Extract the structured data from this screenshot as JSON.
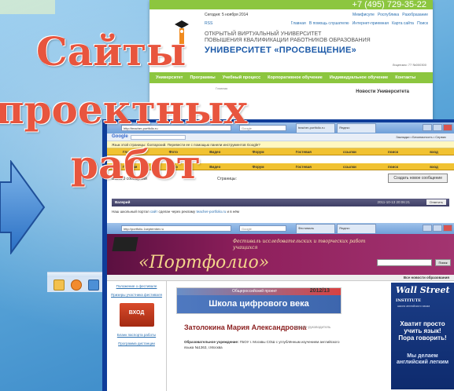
{
  "slide": {
    "title_lines": [
      "Сайты",
      "проектных",
      "работ"
    ],
    "colors": {
      "title": "#e8553e",
      "background": "#5ba6d9",
      "accent_green": "#8cc63f"
    }
  },
  "university_site": {
    "phone": "+7 (495) 729-35-22",
    "date": "Сегодня: 5 ноября 2014",
    "top_links": [
      "Мемфисупе",
      "Роспублика",
      "Разобразание"
    ],
    "rss": "RSS",
    "sub_links": [
      "Главная",
      "В помощь слушателю",
      "Интернет-приемная",
      "Карта сайта",
      "Поиск"
    ],
    "tagline_1": "ОТКРЫТЫЙ ВИРТУАЛЬНЫЙ УНИВЕРСИТЕТ",
    "tagline_2": "ПОВЫШЕНИЯ КВАЛИФИКАЦИИ РАБОТНИКОВ ОБРАЗОВАНИЯ",
    "name": "УНИВЕРСИТЕТ «ПРОСВЕЩЕНИЕ»",
    "license": "Лицензия: 77 №000300",
    "nav": [
      "Университет",
      "Программы",
      "Учебный процесс",
      "Корпоративное обучение",
      "Индивидуальное обучение",
      "Контакты"
    ],
    "breadcrumb": "Главная",
    "news_heading": "Новости Университета"
  },
  "browser_forum": {
    "url": "http://teacher-portfolio.ru",
    "search_placeholder": "Google",
    "tabs": [
      "teacher-portfolio.ru",
      "Яндекс"
    ],
    "google_bar_label": "Google",
    "toolbar_items": "Закладки • Безопасность • Сервис",
    "infobar": "Язык этой страницы: болгарский. Перевести ее с помощью панели инструментов Google?",
    "nav": [
      "Главная",
      "Фото",
      "Видео",
      "Форум",
      "Гостевая",
      "ссылки",
      "поиск",
      "вход"
    ],
    "all_messages": "Всего 0 сообщений",
    "pages_label": "Страницы:",
    "new_message_button": "Создать новое сообщение",
    "post_author": "Валерий",
    "post_date": "2011-10-13 20:06:21",
    "reply_button": "Ответить",
    "post_text_prefix": "Наш школьный портал",
    "post_link_1": "сайт",
    "post_text_mid": "сделан через рекламу",
    "post_link_2": "teacher-portfolio.ru",
    "post_text_suffix": "и в нём"
  },
  "browser_portfolio": {
    "url": "http://portfolio.1september.ru",
    "search_placeholder": "Google",
    "tabs": [
      "Фестиваль",
      "Яндекс"
    ],
    "festival_text": "Фестиваль исследовательских и творческих работ учащихся",
    "portfolio_title": "«Портфолио»",
    "search_button": "Поиск",
    "all_news": "Все новости образования",
    "side_links": [
      "Положение о фестивале",
      "Призеры участника фестиваля",
      "Бланк паспорта работы",
      "Программа дистанции"
    ],
    "login_label": "ВХОД",
    "project_caption": "Общероссийский проект",
    "project_year": "2012/13",
    "project_name": "Школа цифрового века",
    "author_name": "Затолокина Мария Александровна",
    "author_role": "Педагог-руководитель",
    "institution_label": "Образовательное учреждение:",
    "institution_text": "ГБОУ г. Москвы СОШ с углублённым изучением английского языка №1363, г.Москва",
    "ad_brand_1": "Wall Street",
    "ad_brand_2": "INSTITUTE",
    "ad_subbrand": "школа английского языка",
    "ad_slogan_1": "Хватит просто учить язык! Пора говорить!",
    "ad_slogan_2": "Мы делаем английский легким"
  },
  "icons": [
    "arrow-right-icon",
    "window-icon",
    "media-icon",
    "speaker-icon",
    "university-logo-icon"
  ]
}
